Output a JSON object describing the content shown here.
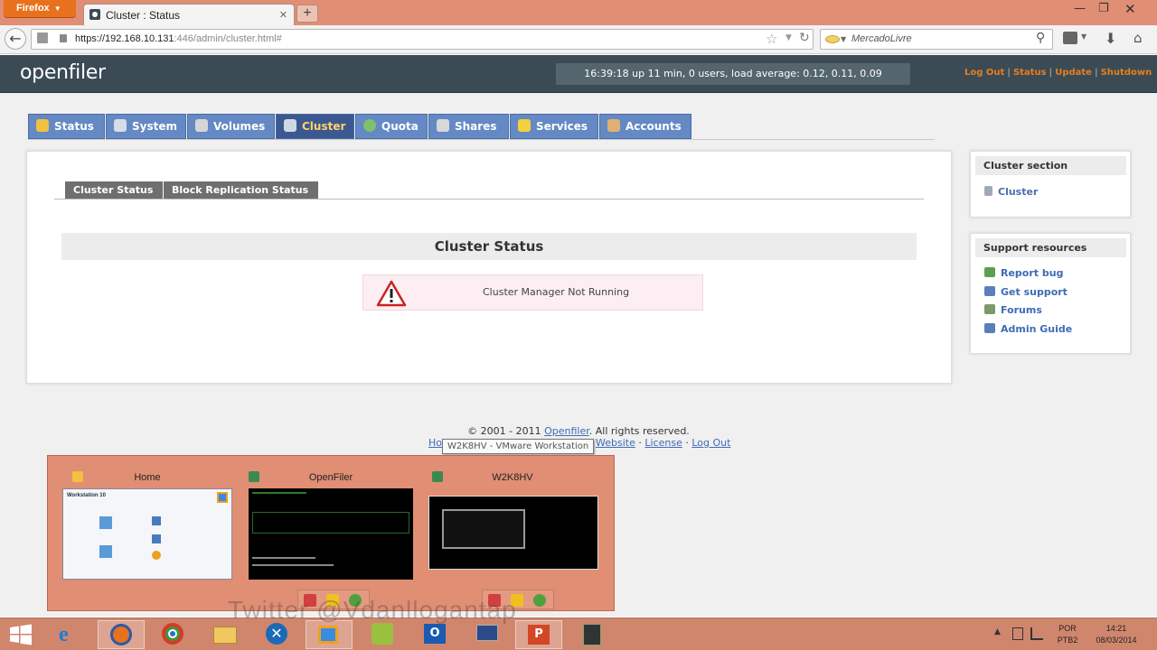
{
  "browser": {
    "menu_button": "Firefox",
    "tab_title": "Cluster : Status",
    "url_host": "https://192.168.10.131",
    "url_rest": ":446/admin/cluster.html#",
    "search_placeholder": "MercadoLivre",
    "new_tab": "+"
  },
  "header": {
    "logo": "openfiler",
    "uptime": "16:39:18 up 11 min, 0 users, load average: 0.12, 0.11, 0.09",
    "links": [
      "Log Out",
      "Status",
      "Update",
      "Shutdown"
    ]
  },
  "nav": {
    "tabs": [
      {
        "label": "Status",
        "icon": "status-icon",
        "color": "#f0c040"
      },
      {
        "label": "System",
        "icon": "system-icon",
        "color": "#d7dde6"
      },
      {
        "label": "Volumes",
        "icon": "volumes-icon",
        "color": "#d6d6d6"
      },
      {
        "label": "Cluster",
        "icon": "cluster-icon",
        "color": "#d0d8e6",
        "active": true
      },
      {
        "label": "Quota",
        "icon": "quota-icon",
        "color": "#7fc06a"
      },
      {
        "label": "Shares",
        "icon": "shares-icon",
        "color": "#d8d8d8"
      },
      {
        "label": "Services",
        "icon": "services-icon",
        "color": "#f3d13c"
      },
      {
        "label": "Accounts",
        "icon": "accounts-icon",
        "color": "#e0b070"
      }
    ]
  },
  "subtabs": [
    "Cluster Status",
    "Block Replication Status"
  ],
  "main": {
    "heading": "Cluster Status",
    "message": "Cluster Manager Not Running"
  },
  "sidebar": {
    "section_title": "Cluster section",
    "section_link": "Cluster",
    "support_title": "Support resources",
    "support_links": [
      "Report bug",
      "Get support",
      "Forums",
      "Admin Guide"
    ]
  },
  "footer": {
    "copyright_prefix": "© 2001 - 2011",
    "copyright_link": "Openfiler",
    "copyright_suffix": ". All rights reserved.",
    "links_prefix": "Ho",
    "links": [
      "Website",
      "License",
      "Log Out"
    ],
    "tooltip": "W2K8HV - VMware Workstation"
  },
  "thumbnails": [
    {
      "title": "Home",
      "subtitle": "Workstation 10"
    },
    {
      "title": "OpenFiler"
    },
    {
      "title": "W2K8HV"
    }
  ],
  "watermark": "Twitter @Vdanllogantap",
  "tray": {
    "lang1": "POR",
    "lang2": "PTB2",
    "time": "14:21",
    "date": "08/03/2014"
  },
  "colors": {
    "accent_orange": "#e87d20",
    "nav_blue": "#6489c4",
    "header_slate": "#3a4b55",
    "link_blue": "#3f6bb5"
  }
}
